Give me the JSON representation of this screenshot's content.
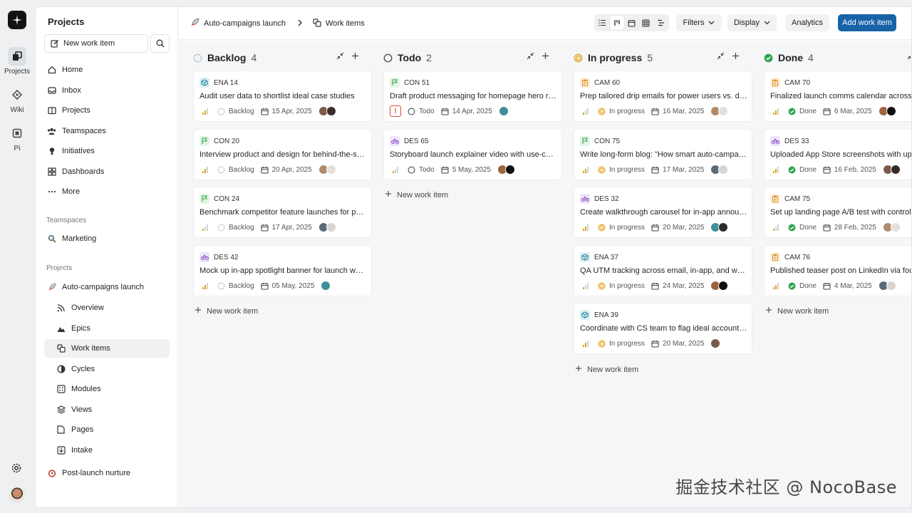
{
  "rail": {
    "items": [
      {
        "label": "Projects",
        "icon": "projects-icon"
      },
      {
        "label": "Wiki",
        "icon": "wiki-icon"
      },
      {
        "label": "Pi",
        "icon": "pi-icon"
      }
    ]
  },
  "sidebar": {
    "title": "Projects",
    "new_work_item": "New work item",
    "nav": [
      "Home",
      "Inbox",
      "Projects",
      "Teamspaces",
      "Initiatives",
      "Dashboards",
      "More"
    ],
    "teamspaces_heading": "Teamspaces",
    "teamspaces": [
      "Marketing"
    ],
    "projects_heading": "Projects",
    "project": "Auto-campaigns launch",
    "project_children": [
      "Overview",
      "Epics",
      "Work items",
      "Cycles",
      "Modules",
      "Views",
      "Pages",
      "Intake"
    ],
    "other_project": "Post-launch nurture"
  },
  "header": {
    "breadcrumb_project": "Auto-campaigns launch",
    "breadcrumb_page": "Work items",
    "filters": "Filters",
    "display": "Display",
    "analytics": "Analytics",
    "add_work_item": "Add work item"
  },
  "columns": [
    {
      "name": "Backlog",
      "count": "4",
      "cards": [
        {
          "id": "ENA 14",
          "kind": "ena",
          "title": "Audit user data to shortlist ideal case studies",
          "status": "Backlog",
          "date": "15 Apr, 2025"
        },
        {
          "id": "CON 20",
          "kind": "con",
          "title": "Interview product and design for behind-the-scenes content",
          "status": "Backlog",
          "date": "20 Apr, 2025"
        },
        {
          "id": "CON 24",
          "kind": "con",
          "title": "Benchmark competitor feature launches for positioning",
          "status": "Backlog",
          "date": "17 Apr, 2025"
        },
        {
          "id": "DES 42",
          "kind": "des",
          "title": "Mock up in-app spotlight banner for launch week",
          "status": "Backlog",
          "date": "05 May, 2025"
        }
      ],
      "add": "New work item"
    },
    {
      "name": "Todo",
      "count": "2",
      "cards": [
        {
          "id": "CON 51",
          "kind": "con",
          "title": "Draft product messaging for homepage hero refresh",
          "status": "Todo",
          "date": "14 Apr, 2025",
          "urgent": true
        },
        {
          "id": "DES 65",
          "kind": "des",
          "title": "Storyboard launch explainer video with use-case flows",
          "status": "Todo",
          "date": "5 May, 2025"
        }
      ],
      "add": "New work item"
    },
    {
      "name": "In progress",
      "count": "5",
      "cards": [
        {
          "id": "CAM 60",
          "kind": "cam",
          "title": "Prep tailored drip emails for power users vs. dormant users",
          "status": "In progress",
          "date": "16 Mar, 2025"
        },
        {
          "id": "CON 75",
          "kind": "con",
          "title": "Write long-form blog: \"How smart auto-campaigns work\"",
          "status": "In progress",
          "date": "17 Mar, 2025"
        },
        {
          "id": "DES 32",
          "kind": "des",
          "title": "Create walkthrough carousel for in-app announcement",
          "status": "In progress",
          "date": "20 Mar, 2025"
        },
        {
          "id": "ENA 37",
          "kind": "ena",
          "title": "QA UTM tracking across email, in-app, and web CTAs",
          "status": "In progress",
          "date": "24 Mar, 2025"
        },
        {
          "id": "ENA 39",
          "kind": "ena",
          "title": "Coordinate with CS team to flag ideal accounts for outreach",
          "status": "In progress",
          "date": "20 Mar, 2025"
        }
      ],
      "add": "New work item"
    },
    {
      "name": "Done",
      "count": "4",
      "cards": [
        {
          "id": "CAM 70",
          "kind": "cam",
          "title": "Finalized launch comms calendar across all channels",
          "status": "Done",
          "date": "6 Mar, 2025"
        },
        {
          "id": "DES 33",
          "kind": "des",
          "title": "Uploaded App Store screenshots with updated visuals",
          "status": "Done",
          "date": "16 Feb, 2025"
        },
        {
          "id": "CAM 75",
          "kind": "cam",
          "title": "Set up landing page A/B test with control variant",
          "status": "Done",
          "date": "28 Feb, 2025"
        },
        {
          "id": "CAM 76",
          "kind": "cam",
          "title": "Published teaser post on LinkedIn via founder account",
          "status": "Done",
          "date": "4 Mar, 2025"
        }
      ],
      "add": "New work item"
    }
  ],
  "watermark": "掘金技术社区 @ NocoBase",
  "colors": {
    "primary": "#1862a8",
    "backlog": "#9aa0a6",
    "in_progress": "#e5a318",
    "done": "#2ea44f",
    "urgent": "#d84b3a"
  }
}
